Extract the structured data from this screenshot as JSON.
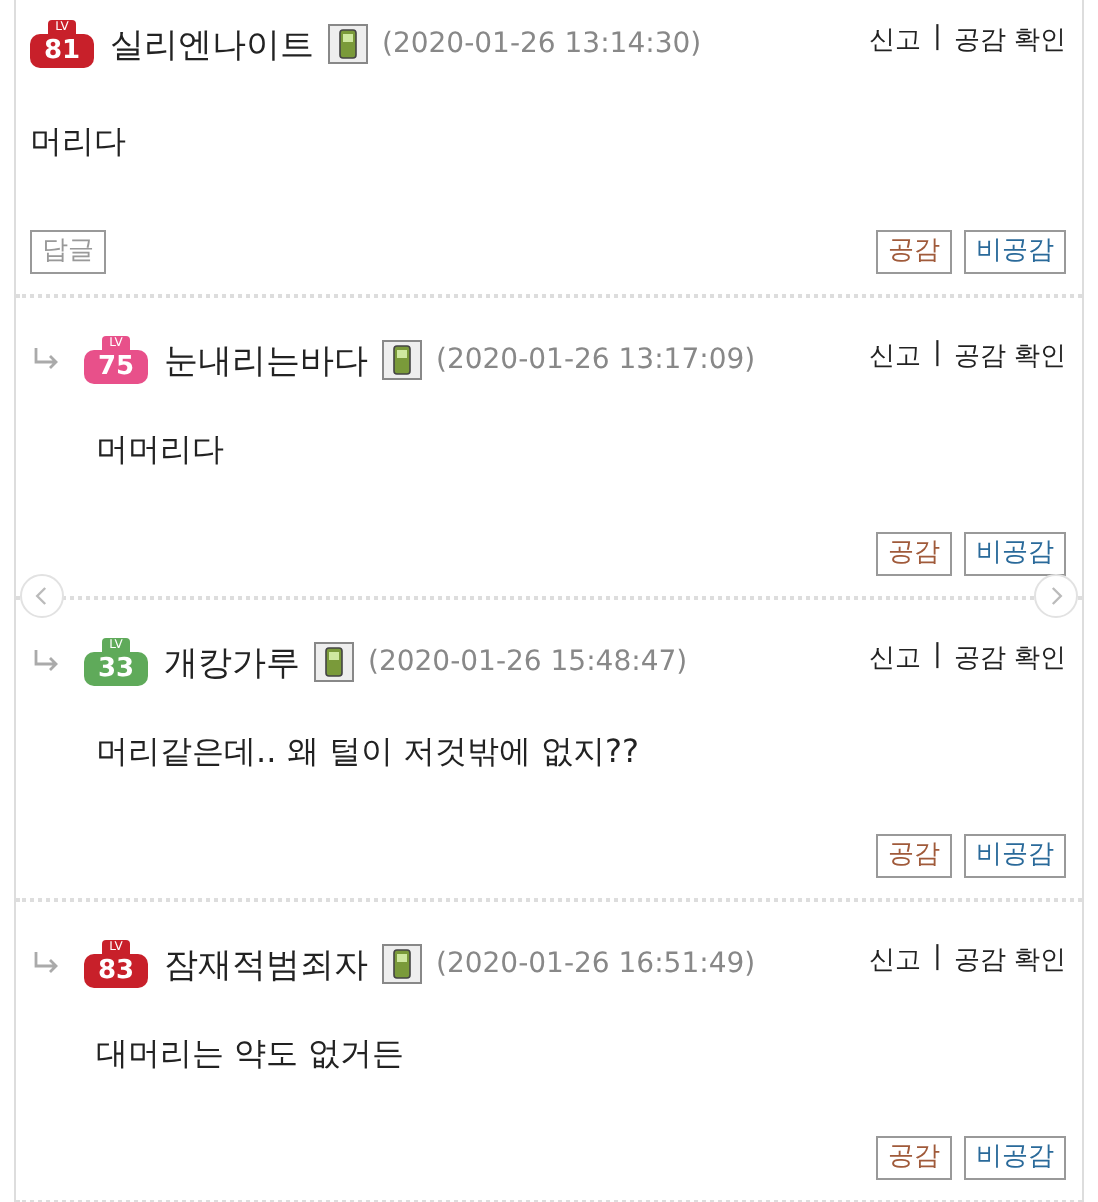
{
  "comments": [
    {
      "kind": "comment",
      "badge": {
        "label": "LV",
        "level": "81",
        "color": "#c8202a"
      },
      "name": "실리엔나이트",
      "time": "(2020-01-26 13:14:30)",
      "report": "신고",
      "separator": "|",
      "check": "공감 확인",
      "body": "머리다",
      "reply_button": "답글",
      "like": "공감",
      "dislike": "비공감"
    },
    {
      "kind": "reply",
      "badge": {
        "label": "LV",
        "level": "75",
        "color": "#e8508a"
      },
      "name": "눈내리는바다",
      "time": "(2020-01-26 13:17:09)",
      "report": "신고",
      "separator": "|",
      "check": "공감 확인",
      "body": "머머리다",
      "like": "공감",
      "dislike": "비공감"
    },
    {
      "kind": "reply",
      "badge": {
        "label": "LV",
        "level": "33",
        "color": "#5faa5a"
      },
      "name": "개캉가루",
      "time": "(2020-01-26 15:48:47)",
      "report": "신고",
      "separator": "|",
      "check": "공감 확인",
      "body": "머리같은데.. 왜 털이 저것밖에 없지??",
      "like": "공감",
      "dislike": "비공감"
    },
    {
      "kind": "reply",
      "badge": {
        "label": "LV",
        "level": "83",
        "color": "#c8202a"
      },
      "name": "잠재적범죄자",
      "time": "(2020-01-26 16:51:49)",
      "report": "신고",
      "separator": "|",
      "check": "공감 확인",
      "body": "대머리는 약도 없거든",
      "like": "공감",
      "dislike": "비공감"
    }
  ]
}
